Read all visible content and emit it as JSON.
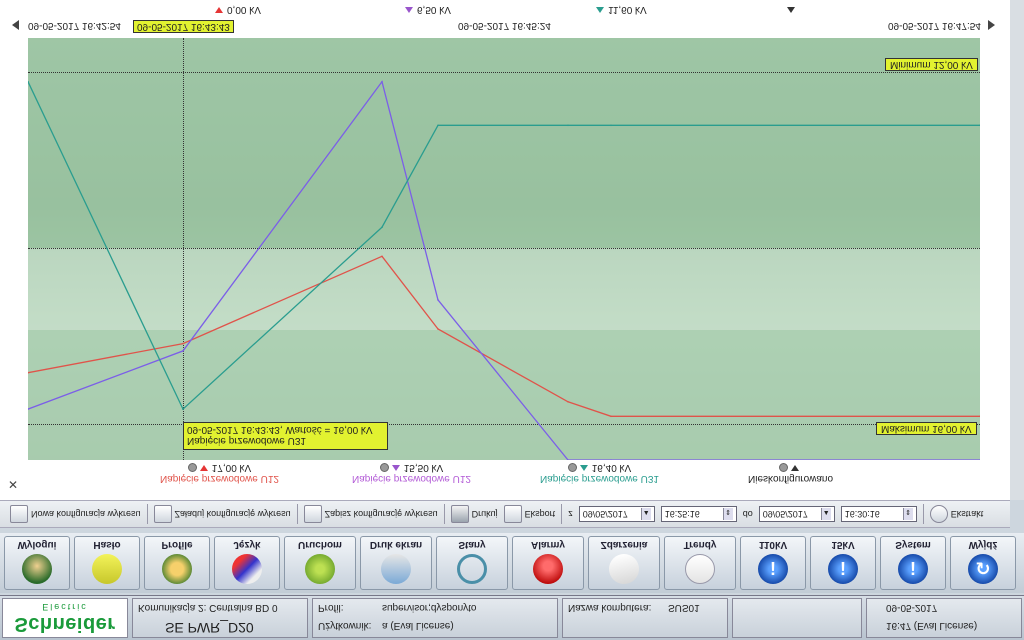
{
  "top_scale": {
    "series_labels": [
      {
        "marker": "tri-down",
        "text": "0,00 kV"
      },
      {
        "marker": "tri-purple",
        "text": "6,50 kV"
      },
      {
        "marker": "tri-teal",
        "text": "11,60 kV"
      },
      {
        "marker": "tri-black",
        "text": ""
      }
    ],
    "date_left": "09-05-2017 16:42:54",
    "date_cursor": "09-05-2017 16:43:43",
    "date_mid": "09-05-2017 16:45:24",
    "date_right": "09-05-2017 16:47:54"
  },
  "badges": {
    "minimum": "Minimum 12,00 kV",
    "maximum": "Maksimum 16,00 kV"
  },
  "cursor_box": {
    "line1": "09-05-2017 16:43:43, Wartość = 16,00 kV",
    "line2": "Napięcie przewodowe U31"
  },
  "legend": [
    {
      "value": "17,00 kV",
      "name": "Napięcie przewodowe U12",
      "color": "#e0534a"
    },
    {
      "value": "15,50 kV",
      "name": "Napięcie przewodowe U12",
      "color": "#b25ad6"
    },
    {
      "value": "16,40 kV",
      "name": "Napięcie przewodowe U31",
      "color": "#2a9d8f"
    },
    {
      "value": "",
      "name": "Nieskonfigurowano",
      "color": "#222222"
    }
  ],
  "toolbar": {
    "new_config": "Nowa konfiguracja wykresu",
    "load_config": "Załaduj konfigurację wykresu",
    "save_config": "Zapisz konfigurację wykresu",
    "print": "Drukuj",
    "export": "Eksport",
    "from_label": "z",
    "from_date": "09/05/2017",
    "from_time": "16:25:16",
    "to_label": "do",
    "to_date": "09/05/2017",
    "to_time": "16:30:16",
    "extract": "Ekstrakt"
  },
  "nav": [
    {
      "label": "Wylogui",
      "icon": "user-icon"
    },
    {
      "label": "Hasło",
      "icon": "key-icon"
    },
    {
      "label": "Profile",
      "icon": "group-icon"
    },
    {
      "label": "Język",
      "icon": "language-icon"
    },
    {
      "label": "Uruchom",
      "icon": "start-icon"
    },
    {
      "label": "Druk ekran",
      "icon": "print-screen-icon"
    },
    {
      "label": "Stany",
      "icon": "states-icon"
    },
    {
      "label": "Alarmy",
      "icon": "alarm-icon"
    },
    {
      "label": "Zdarzenia",
      "icon": "events-icon"
    },
    {
      "label": "Trendy",
      "icon": "trends-icon"
    },
    {
      "label": "110kV",
      "icon": "info-icon"
    },
    {
      "label": "15kV",
      "icon": "info-icon"
    },
    {
      "label": "System",
      "icon": "info-icon"
    },
    {
      "label": "Wyjdź",
      "icon": "exit-icon"
    }
  ],
  "status": {
    "brand": "Schneider",
    "brand_sub": "Electric",
    "comm": "Komunikacja 2: Centralna BD 0",
    "station": "SE PWR_D20",
    "profile_label": "Profil:",
    "profile_value": "supervisor;dysponyto",
    "user_label": "Użytkownik:",
    "user_value": "a (Eval License)",
    "computer_label": "Nazwa komputera:",
    "computer_value": "SUS01",
    "date": "09-05-2017",
    "time": "16:47 (Eval License)"
  },
  "chart_data": {
    "type": "line",
    "x": [
      "16:42:54",
      "16:43:43",
      "16:44:30",
      "16:45:24",
      "16:46:10",
      "16:47:00",
      "16:47:54"
    ],
    "series": [
      {
        "name": "Napięcie przewodowe U12",
        "color": "#e0534a",
        "values": [
          12.0,
          12.4,
          13.6,
          12.6,
          11.6,
          11.4,
          11.4
        ]
      },
      {
        "name": "Napięcie przewodowe U12",
        "color": "#7b5ee8",
        "values": [
          11.5,
          12.3,
          16.0,
          13.0,
          10.8,
          10.8,
          10.8
        ]
      },
      {
        "name": "Napięcie przewodowe U31",
        "color": "#2a9d8f",
        "values": [
          16.0,
          11.5,
          14.0,
          15.4,
          15.4,
          15.4,
          15.4
        ]
      }
    ],
    "ylim": [
      10.8,
      16.6
    ],
    "ref_lines": [
      16.0,
      11.5
    ]
  }
}
